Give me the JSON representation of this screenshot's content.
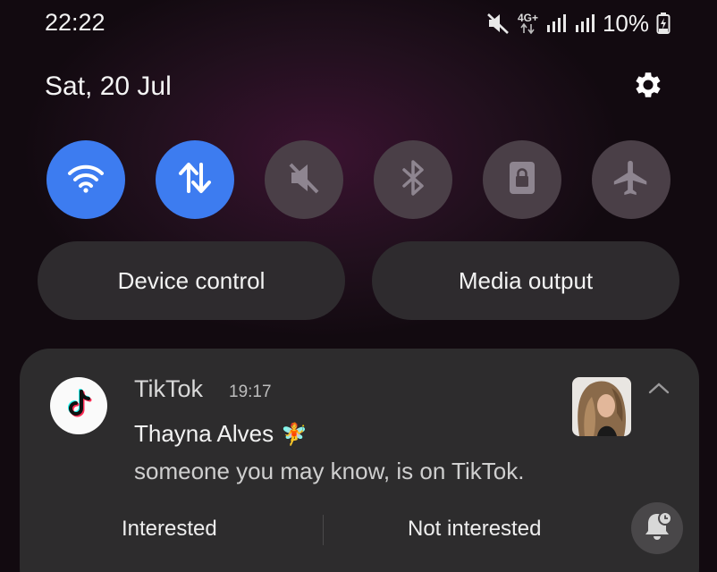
{
  "status_bar": {
    "time": "22:22",
    "network_label_top": "4G+",
    "battery_percent": "10%",
    "icons": [
      "mute-icon",
      "data-arrows-icon",
      "signal-icon",
      "signal-icon",
      "battery-charging-icon"
    ]
  },
  "header": {
    "date": "Sat, 20 Jul",
    "settings_icon": "gear-icon"
  },
  "quick_settings": {
    "tiles": [
      {
        "name": "wifi",
        "icon": "wifi-icon",
        "active": true
      },
      {
        "name": "mobile-data",
        "icon": "data-arrows-icon",
        "active": true
      },
      {
        "name": "sound",
        "icon": "mute-icon",
        "active": false
      },
      {
        "name": "bluetooth",
        "icon": "bluetooth-icon",
        "active": false
      },
      {
        "name": "rotation-lock",
        "icon": "lock-icon",
        "active": false
      },
      {
        "name": "airplane-mode",
        "icon": "airplane-icon",
        "active": false
      }
    ],
    "device_control_label": "Device control",
    "media_output_label": "Media output"
  },
  "notification": {
    "app_name": "TikTok",
    "time": "19:17",
    "title": "Thayna Alves",
    "title_emoji": "🧚",
    "body": "someone you may know, is on TikTok.",
    "action_interested": "Interested",
    "action_not_interested": "Not interested"
  },
  "colors": {
    "tile_active": "#3d7cf0",
    "tile_inactive": "#4a3f47",
    "card_bg": "#2d2c2d",
    "pill_bg": "#2e2b2e"
  }
}
